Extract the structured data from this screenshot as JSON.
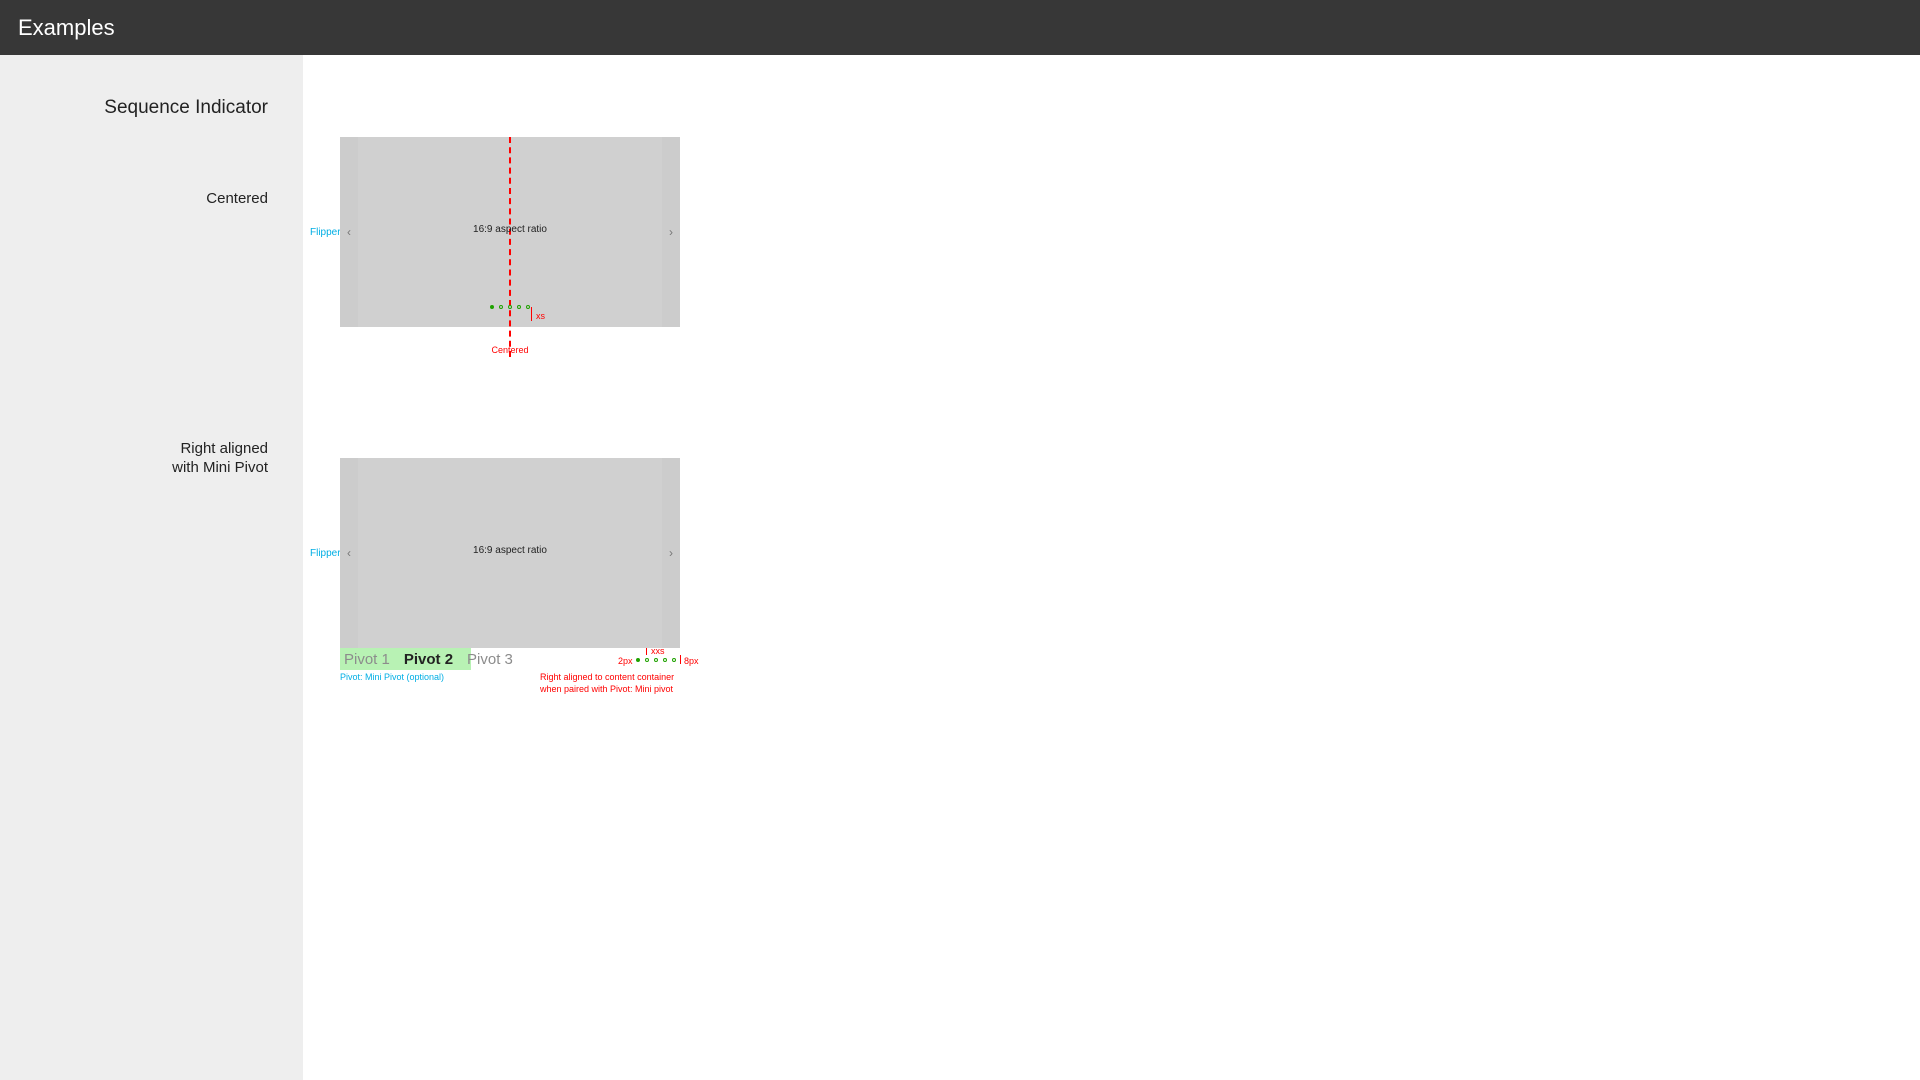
{
  "header": {
    "title": "Examples"
  },
  "section": {
    "title": "Sequence Indicator"
  },
  "examples": {
    "centered": {
      "label": "Centered",
      "flipper": "Flipper",
      "aspect": "16:9 aspect ratio",
      "dots_spacing_anno": "xs",
      "caption": "Centered"
    },
    "right": {
      "label_line1": "Right aligned",
      "label_line2": "with Mini Pivot",
      "flipper": "Flipper",
      "aspect": "16:9 aspect ratio",
      "pivot1": "Pivot 1",
      "pivot2": "Pivot 2",
      "pivot3": "Pivot 3",
      "pivot_anno": "Pivot: Mini Pivot (optional)",
      "left_gap": "2px",
      "right_gap": "8px",
      "top_gap": "xxs",
      "caption_line1": "Right aligned to content container",
      "caption_line2": "when paired with Pivot: Mini pivot"
    }
  },
  "glyphs": {
    "left": "‹",
    "right": "›"
  }
}
